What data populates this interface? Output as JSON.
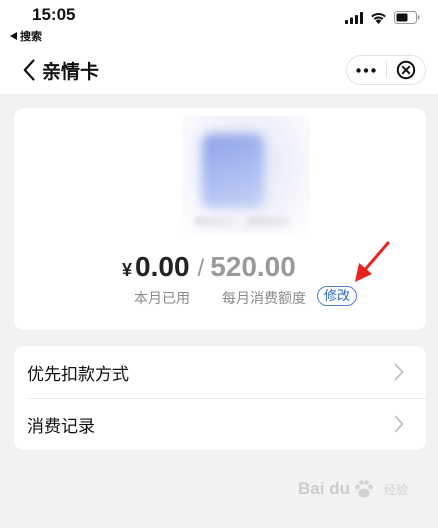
{
  "status_bar": {
    "time": "15:05",
    "back_app_label": "搜索",
    "icons": [
      "back-triangle-icon",
      "signal-icon",
      "wifi-icon",
      "battery-icon"
    ]
  },
  "nav": {
    "title": "亲情卡",
    "back_icon": "chevron-left-icon",
    "more_icon": "more-dots-icon",
    "close_icon": "close-circle-icon"
  },
  "card": {
    "currency": "¥",
    "used_amount": "0.00",
    "separator": "/",
    "monthly_limit": "520.00",
    "used_label": "本月已用",
    "limit_label": "每月消费额度",
    "modify_label": "修改",
    "annotation_arrow_color": "#e8231e"
  },
  "menu": {
    "items": [
      {
        "label": "优先扣款方式",
        "icon": "chevron-right-icon"
      },
      {
        "label": "消费记录",
        "icon": "chevron-right-icon"
      }
    ]
  },
  "watermark": {
    "logo_text": "Bai du",
    "sub_text": "经验",
    "icon": "paw-icon"
  },
  "colors": {
    "accent_blue": "#2d66c8",
    "background": "#f2f2f2",
    "muted_text": "#9a9a9a"
  }
}
